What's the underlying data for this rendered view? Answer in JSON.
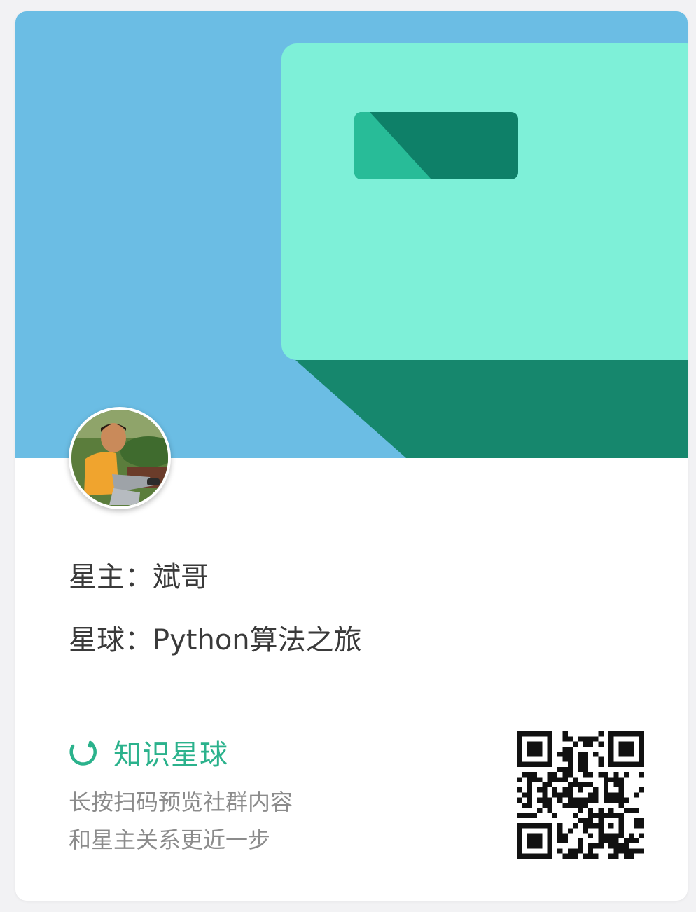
{
  "colors": {
    "banner_blue": "#6bbde4",
    "panel_mint": "#7ef0d8",
    "panel_shadow": "#16876d",
    "slot_dark": "#0e8068",
    "slot_light": "#28bc98",
    "brand_green": "#2bb28c"
  },
  "owner": {
    "label": "星主：",
    "name": "斌哥"
  },
  "planet": {
    "label": "星球：",
    "name": "Python算法之旅"
  },
  "brand": {
    "icon": "zsxq-ring-icon",
    "name": "知识星球"
  },
  "description": {
    "line1": "长按扫码预览社群内容",
    "line2": "和星主关系更近一步"
  },
  "avatar": {
    "icon": "person-photo"
  },
  "qr": {
    "icon": "qr-code"
  }
}
